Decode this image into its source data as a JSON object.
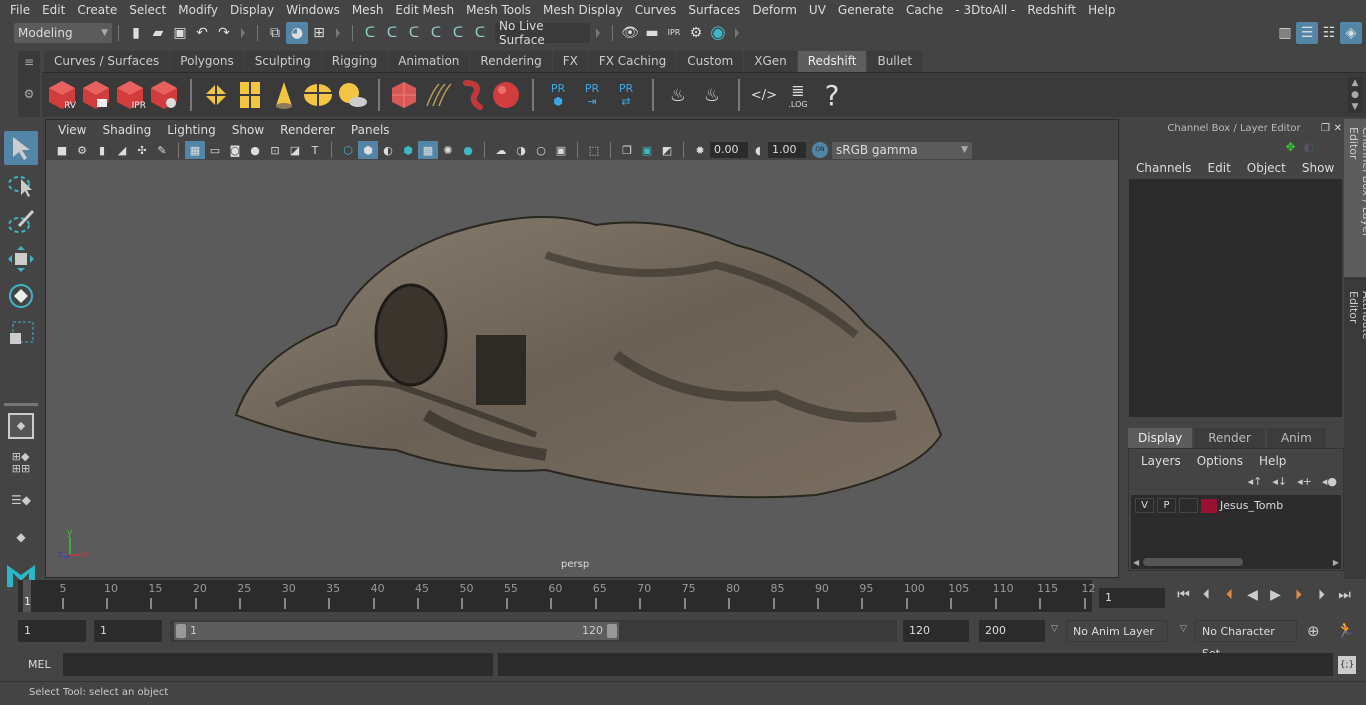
{
  "menubar": {
    "items": [
      "File",
      "Edit",
      "Create",
      "Select",
      "Modify",
      "Display",
      "Windows",
      "Mesh",
      "Edit Mesh",
      "Mesh Tools",
      "Mesh Display",
      "Curves",
      "Surfaces",
      "Deform",
      "UV",
      "Generate",
      "Cache",
      "- 3DtoAll -",
      "Redshift",
      "Help"
    ]
  },
  "statusline": {
    "workspace": "Modeling",
    "live_surface": "No Live Surface"
  },
  "shelf": {
    "tabs": [
      "Curves / Surfaces",
      "Polygons",
      "Sculpting",
      "Rigging",
      "Animation",
      "Rendering",
      "FX",
      "FX Caching",
      "Custom",
      "XGen",
      "Redshift",
      "Bullet"
    ],
    "active_tab": "Redshift",
    "icon_labels": {
      "rv": "RV",
      "ipr": "IPR",
      "pr": "PR",
      "log": ".LOG",
      "help": "?"
    }
  },
  "viewport": {
    "menu": [
      "View",
      "Shading",
      "Lighting",
      "Show",
      "Renderer",
      "Panels"
    ],
    "exposure": "0.00",
    "gamma": "1.00",
    "color_mgmt_toggle": "ON",
    "color_space": "sRGB gamma",
    "camera_label": "persp",
    "axis": {
      "x": "x",
      "y": "y",
      "z": "z"
    }
  },
  "channel_box": {
    "title": "Channel Box / Layer Editor",
    "menu": [
      "Channels",
      "Edit",
      "Object",
      "Show"
    ]
  },
  "layer_editor": {
    "tabs": [
      "Display",
      "Render",
      "Anim"
    ],
    "active_tab": "Display",
    "menu": [
      "Layers",
      "Options",
      "Help"
    ],
    "layers": [
      {
        "v": "V",
        "p": "P",
        "color": "#9a1030",
        "name": "Jesus_Tomb"
      }
    ]
  },
  "side_tabs": [
    "Channel Box / Layer Editor",
    "Attribute Editor"
  ],
  "timeline": {
    "current_frame_label": "1",
    "ticks": [
      "5",
      "10",
      "15",
      "20",
      "25",
      "30",
      "35",
      "40",
      "45",
      "50",
      "55",
      "60",
      "65",
      "70",
      "75",
      "80",
      "85",
      "90",
      "95",
      "100",
      "105",
      "110",
      "115",
      "12"
    ],
    "current_frame": "1"
  },
  "range": {
    "start": "1",
    "anim_start": "1",
    "slider_start": "1",
    "slider_end": "120",
    "end": "120",
    "anim_end": "200",
    "anim_layer": "No Anim Layer",
    "character_set": "No Character Set"
  },
  "command_line": {
    "label": "MEL"
  },
  "help_line": {
    "text": "Select Tool: select an object"
  },
  "colors": {
    "accent": "#5285a6",
    "teal": "#3fb6c6",
    "redshift": "#d23c3c",
    "yellow": "#f4c542"
  }
}
